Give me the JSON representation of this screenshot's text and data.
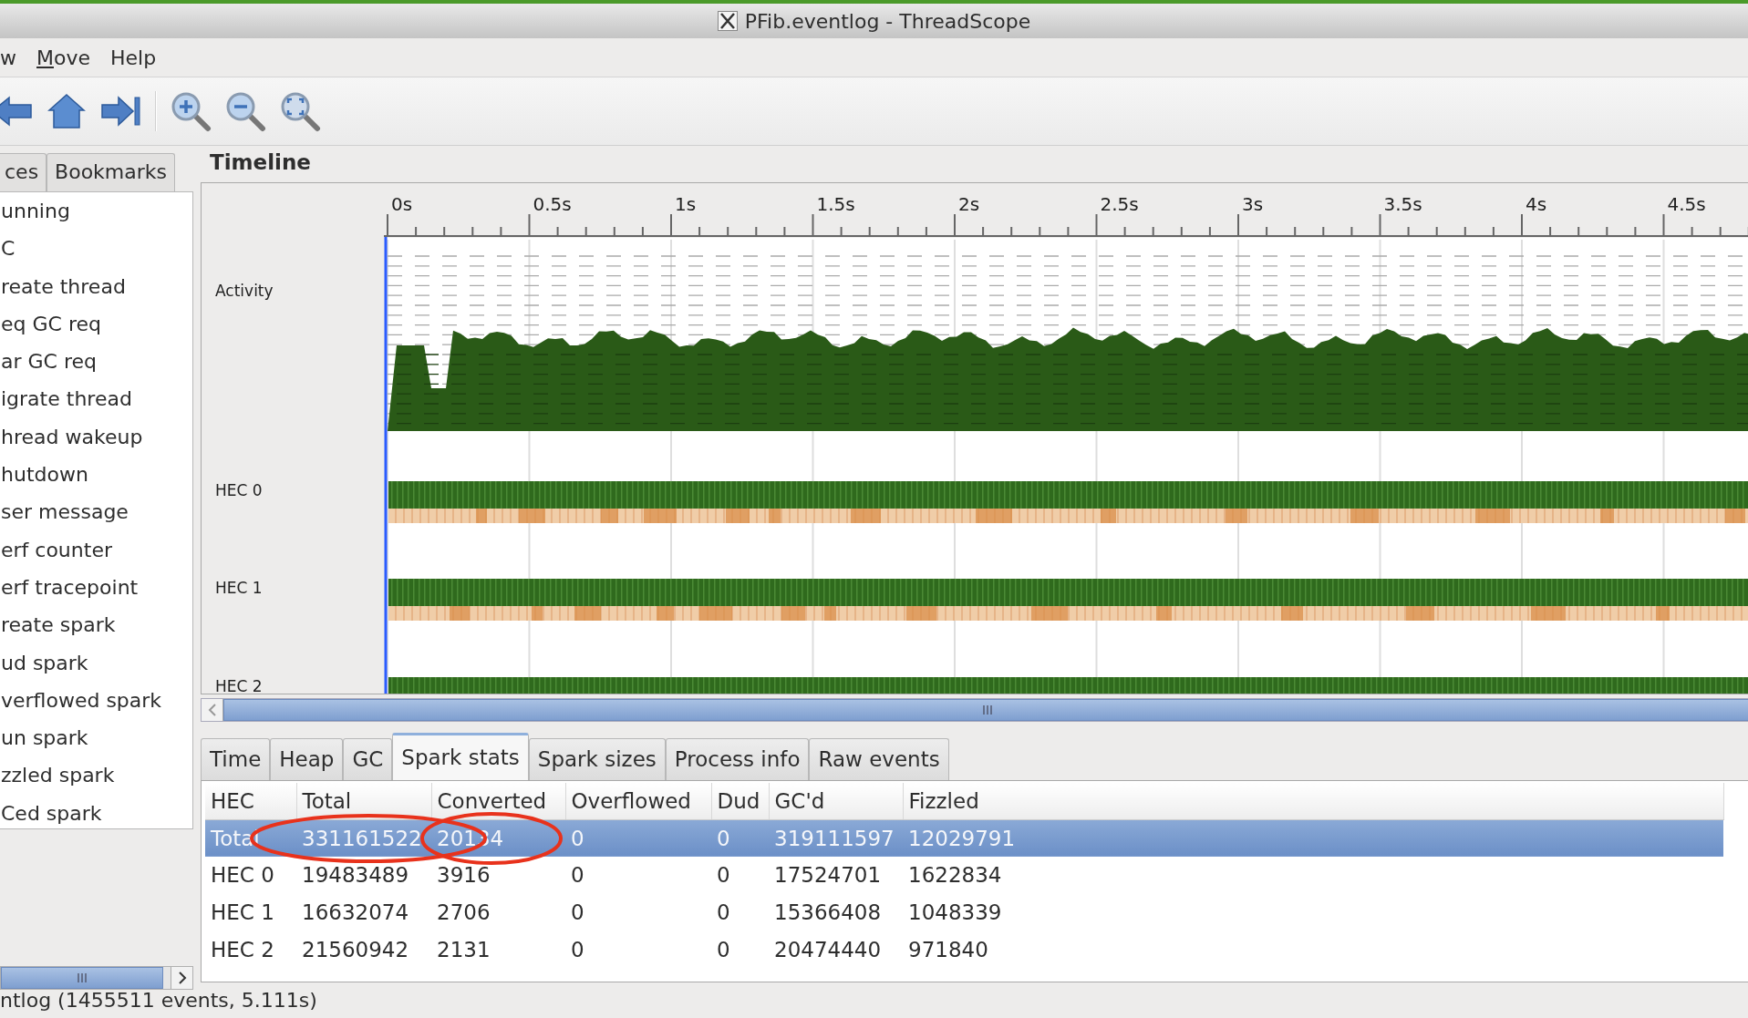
{
  "window": {
    "title": "PFib.eventlog - ThreadScope"
  },
  "menu": [
    {
      "label": "w",
      "mnemonic": false
    },
    {
      "label": "Move",
      "mnemonic": true
    },
    {
      "label": "Help",
      "mnemonic": false
    }
  ],
  "toolbar": [
    {
      "kind": "back"
    },
    {
      "kind": "home"
    },
    {
      "kind": "end"
    },
    {
      "kind": "separator"
    },
    {
      "kind": "zoom-in"
    },
    {
      "kind": "zoom-out"
    },
    {
      "kind": "zoom-fit"
    }
  ],
  "side_tabs": [
    {
      "label": "ces",
      "selected": false
    },
    {
      "label": "Bookmarks",
      "selected": false
    }
  ],
  "key_list": [
    "unning",
    "C",
    "reate thread",
    "eq GC req",
    "ar GC req",
    "igrate thread",
    "hread wakeup",
    "hutdown",
    "ser message",
    "erf counter",
    "erf tracepoint",
    "reate spark",
    "ud spark",
    "verflowed spark",
    "un spark",
    "zzled spark",
    "Ced spark"
  ],
  "timeline": {
    "title": "Timeline",
    "ticks": [
      "0s",
      "0.5s",
      "1s",
      "1.5s",
      "2s",
      "2.5s",
      "3s",
      "3.5s",
      "4s",
      "4.5s"
    ],
    "tracks": [
      {
        "label": "Activity",
        "kind": "activity"
      },
      {
        "label": "HEC 0",
        "kind": "hec"
      },
      {
        "label": "HEC 1",
        "kind": "hec"
      },
      {
        "label": "HEC 2",
        "kind": "hec"
      }
    ]
  },
  "bottom_tabs": [
    {
      "label": "Time",
      "selected": false
    },
    {
      "label": "Heap",
      "selected": false
    },
    {
      "label": "GC",
      "selected": false
    },
    {
      "label": "Spark stats",
      "selected": true
    },
    {
      "label": "Spark sizes",
      "selected": false
    },
    {
      "label": "Process info",
      "selected": false
    },
    {
      "label": "Raw events",
      "selected": false
    }
  ],
  "table": {
    "columns": [
      "HEC",
      "Total",
      "Converted",
      "Overflowed",
      "Dud",
      "GC'd",
      "Fizzled"
    ],
    "rows": [
      {
        "cells": [
          "Total",
          "331161522",
          "20134",
          "0",
          "0",
          "319111597",
          "12029791"
        ],
        "selected": true
      },
      {
        "cells": [
          "HEC 0",
          "19483489",
          "3916",
          "0",
          "0",
          "17524701",
          "1622834"
        ],
        "selected": false
      },
      {
        "cells": [
          "HEC 1",
          "16632074",
          "2706",
          "0",
          "0",
          "15366408",
          "1048339"
        ],
        "selected": false
      },
      {
        "cells": [
          "HEC 2",
          "21560942",
          "2131",
          "0",
          "0",
          "20474440",
          "971840"
        ],
        "selected": false
      }
    ]
  },
  "status_bar": "ntlog (1455511 events, 5.111s)"
}
